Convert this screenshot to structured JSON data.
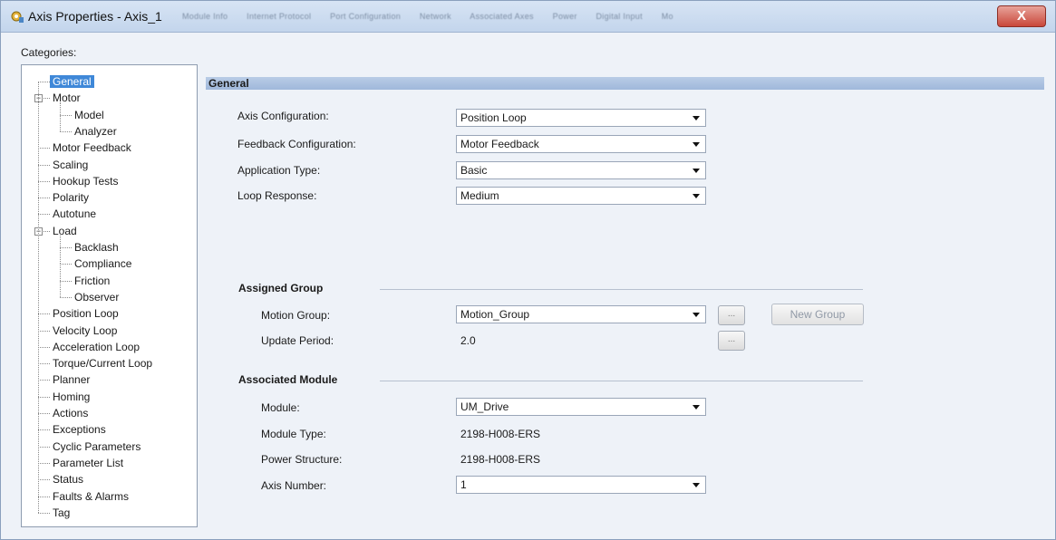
{
  "window": {
    "title": "Axis Properties - Axis_1",
    "close_label": "X",
    "ghost_tabs": [
      "Module Info",
      "Internet Protocol",
      "Port Configuration",
      "Network",
      "Associated Axes",
      "Power",
      "Digital Input",
      "Mo"
    ]
  },
  "categories": {
    "label": "Categories:",
    "items": [
      {
        "label": "General",
        "level": 0,
        "selected": true
      },
      {
        "label": "Motor",
        "level": 0,
        "expander": "−"
      },
      {
        "label": "Model",
        "level": 1
      },
      {
        "label": "Analyzer",
        "level": 1
      },
      {
        "label": "Motor Feedback",
        "level": 0
      },
      {
        "label": "Scaling",
        "level": 0
      },
      {
        "label": "Hookup Tests",
        "level": 0
      },
      {
        "label": "Polarity",
        "level": 0
      },
      {
        "label": "Autotune",
        "level": 0
      },
      {
        "label": "Load",
        "level": 0,
        "expander": "−"
      },
      {
        "label": "Backlash",
        "level": 1
      },
      {
        "label": "Compliance",
        "level": 1
      },
      {
        "label": "Friction",
        "level": 1
      },
      {
        "label": "Observer",
        "level": 1
      },
      {
        "label": "Position Loop",
        "level": 0
      },
      {
        "label": "Velocity Loop",
        "level": 0
      },
      {
        "label": "Acceleration Loop",
        "level": 0
      },
      {
        "label": "Torque/Current Loop",
        "level": 0
      },
      {
        "label": "Planner",
        "level": 0
      },
      {
        "label": "Homing",
        "level": 0
      },
      {
        "label": "Actions",
        "level": 0
      },
      {
        "label": "Exceptions",
        "level": 0
      },
      {
        "label": "Cyclic Parameters",
        "level": 0
      },
      {
        "label": "Parameter List",
        "level": 0
      },
      {
        "label": "Status",
        "level": 0
      },
      {
        "label": "Faults & Alarms",
        "level": 0
      },
      {
        "label": "Tag",
        "level": 0
      }
    ]
  },
  "general": {
    "header": "General",
    "axis_configuration": {
      "label": "Axis Configuration:",
      "value": "Position Loop"
    },
    "feedback_configuration": {
      "label": "Feedback Configuration:",
      "value": "Motor Feedback"
    },
    "application_type": {
      "label": "Application Type:",
      "value": "Basic"
    },
    "loop_response": {
      "label": "Loop Response:",
      "value": "Medium"
    }
  },
  "assigned_group": {
    "title": "Assigned Group",
    "motion_group": {
      "label": "Motion Group:",
      "value": "Motion_Group"
    },
    "update_period": {
      "label": "Update Period:",
      "value": "2.0"
    },
    "browse_label": "...",
    "new_group_label": "New Group"
  },
  "associated_module": {
    "title": "Associated Module",
    "module": {
      "label": "Module:",
      "value": "UM_Drive"
    },
    "module_type": {
      "label": "Module Type:",
      "value": "2198-H008-ERS"
    },
    "power_structure": {
      "label": "Power Structure:",
      "value": "2198-H008-ERS"
    },
    "axis_number": {
      "label": "Axis Number:",
      "value": "1"
    }
  }
}
